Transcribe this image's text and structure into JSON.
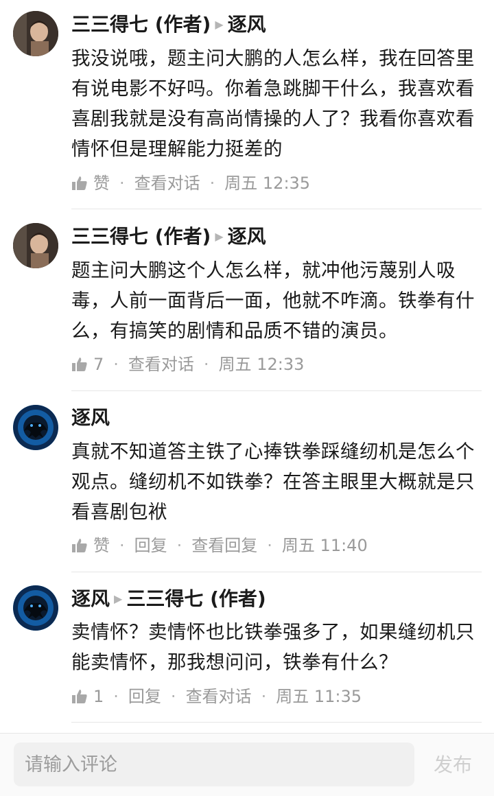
{
  "comments": [
    {
      "author": "三三得七 (作者)",
      "reply_to": "逐风",
      "text": "我没说哦，题主问大鹏的人怎么样，我在回答里有说电影不好吗。你着急跳脚干什么，我喜欢看喜剧我就是没有高尚情操的人了？我看你喜欢看情怀但是理解能力挺差的",
      "likes": "赞",
      "actions": [
        "查看对话"
      ],
      "time": "周五 12:35",
      "avatar_icon": "author-avatar"
    },
    {
      "author": "三三得七 (作者)",
      "reply_to": "逐风",
      "text": "题主问大鹏这个人怎么样，就冲他污蔑别人吸毒，人前一面背后一面，他就不咋滴。铁拳有什么，有搞笑的剧情和品质不错的演员。",
      "likes": "7",
      "actions": [
        "查看对话"
      ],
      "time": "周五 12:33",
      "avatar_icon": "author-avatar"
    },
    {
      "author": "逐风",
      "reply_to": "",
      "text": "真就不知道答主铁了心捧铁拳踩缝纫机是怎么个观点。缝纫机不如铁拳？在答主眼里大概就是只看喜剧包袱",
      "likes": "赞",
      "actions": [
        "回复",
        "查看回复"
      ],
      "time": "周五 11:40",
      "avatar_icon": "frog-avatar"
    },
    {
      "author": "逐风",
      "reply_to": "三三得七 (作者)",
      "text": "卖情怀？卖情怀也比铁拳强多了，如果缝纫机只能卖情怀，那我想问问，铁拳有什么？",
      "likes": "1",
      "actions": [
        "回复",
        "查看对话"
      ],
      "time": "周五 11:35",
      "avatar_icon": "frog-avatar"
    }
  ],
  "input": {
    "placeholder": "请输入评论",
    "publish_label": "发布"
  },
  "colors": {
    "text": "#1a1a1a",
    "meta": "#9a9a9a",
    "divider": "#e6e6e6"
  }
}
